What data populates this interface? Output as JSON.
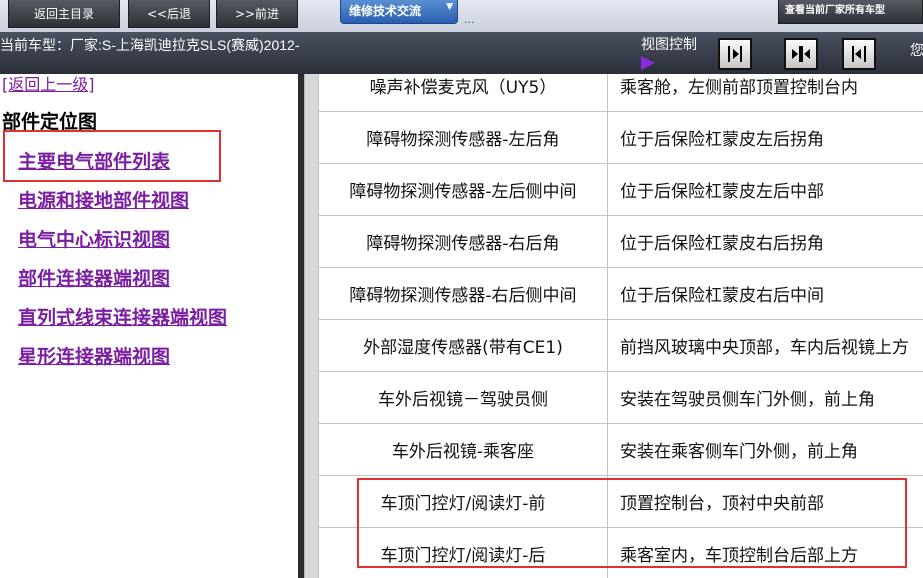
{
  "toolbar": {
    "home_label": "返回主目录",
    "back_label": "<<后退",
    "forward_label": ">>前进",
    "tech_tab_label": "维修技术交流",
    "tech_tab_more": "...",
    "view_all_label": "查看当前厂家所有车型"
  },
  "infobar": {
    "vehicle_label": "当前车型：厂家:S-上海凯迪拉克SLS(赛威)2012-",
    "view_control_label": "视图控制",
    "greeting": "您"
  },
  "sidebar": {
    "up_level": "[返回上一级]",
    "title": "部件定位图",
    "links": [
      "主要电气部件列表",
      "电源和接地部件视图",
      "电气中心标识视图",
      "部件连接器端视图",
      "直列式线束连接器端视图",
      "星形连接器端视图"
    ]
  },
  "table": {
    "rows": [
      {
        "name": "噪声补偿麦克风（UY5）",
        "location": "乘客舱，左侧前部顶置控制台内"
      },
      {
        "name": "障碍物探测传感器-左后角",
        "location": "位于后保险杠蒙皮左后拐角"
      },
      {
        "name": "障碍物探测传感器-左后侧中间",
        "location": "位于后保险杠蒙皮左后中部"
      },
      {
        "name": "障碍物探测传感器-右后角",
        "location": "位于后保险杠蒙皮右后拐角"
      },
      {
        "name": "障碍物探测传感器-右后侧中间",
        "location": "位于后保险杠蒙皮右后中间"
      },
      {
        "name": "外部湿度传感器(带有CE1)",
        "location": "前挡风玻璃中央顶部，车内后视镜上方"
      },
      {
        "name": "车外后视镜－驾驶员侧",
        "location": "安装在驾驶员侧车门外侧，前上角"
      },
      {
        "name": "车外后视镜-乘客座",
        "location": "安装在乘客侧车门外侧，前上角"
      },
      {
        "name": "车顶门控灯/阅读灯-前",
        "location": "顶置控制台，顶衬中央前部"
      },
      {
        "name": "车顶门控灯/阅读灯-后",
        "location": "乘客室内，车顶控制台后部上方"
      }
    ]
  },
  "colors": {
    "highlight": "#e03030",
    "link": "#7b1fa2",
    "tech_tab": "#2a5fb0"
  },
  "icons": [
    "play-arrow-icon",
    "align-right-icon",
    "align-center-icon",
    "align-left-icon"
  ]
}
